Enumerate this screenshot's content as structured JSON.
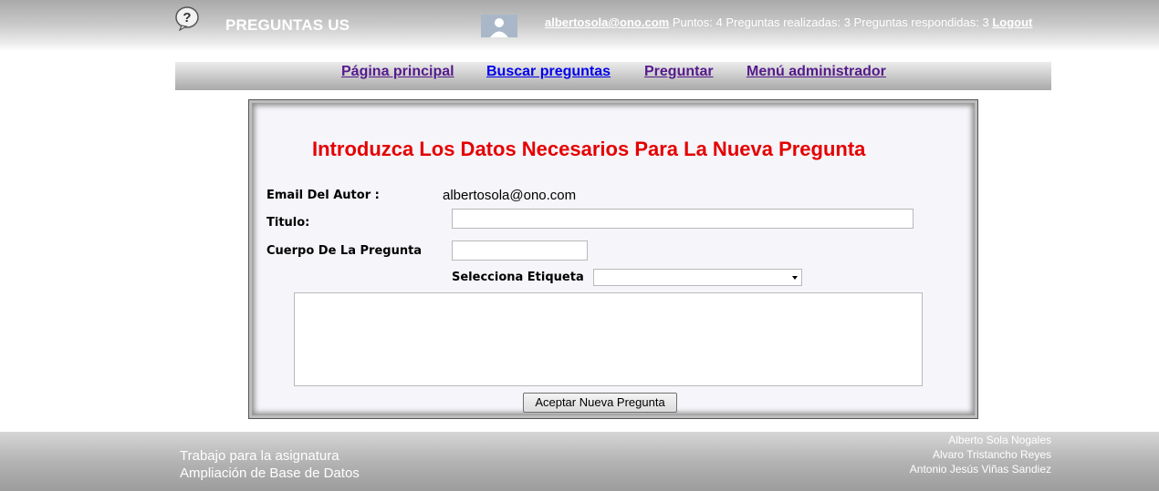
{
  "header": {
    "site_title": "PREGUNTAS US",
    "user_email": "albertosola@ono.com",
    "stats": " Puntos: 4 Preguntas realizadas: 3 Preguntas respondidas: 3 ",
    "logout_label": "Logout",
    "logo_icon": "question-bubble-icon",
    "avatar_icon": "user-avatar-icon"
  },
  "nav": {
    "items": [
      {
        "label": "Página principal"
      },
      {
        "label": "Buscar preguntas"
      },
      {
        "label": "Preguntar"
      },
      {
        "label": "Menú administrador"
      }
    ]
  },
  "form": {
    "title": "Introduzca Los Datos Necesarios Para La Nueva Pregunta",
    "author_label": "Email Del Autor :",
    "author_value": "albertosola@ono.com",
    "title_label": "Titulo:",
    "title_value": "",
    "body_label": "Cuerpo De La Pregunta",
    "body_value": "",
    "tag_label": "Selecciona Etiqueta",
    "tag_value": "",
    "textarea_value": "",
    "submit_label": "Aceptar Nueva Pregunta"
  },
  "footer": {
    "left_line1": "Trabajo para la asignatura",
    "left_line2": "Ampliación de Base de Datos",
    "authors": [
      "Alberto Sola Nogales",
      "Alvaro Tristancho Reyes",
      "Antonio Jesús Viñas Sandiez"
    ]
  },
  "colors": {
    "title_red": "#e50000",
    "link_visited": "#551a8b",
    "link_active": "#0000ee"
  }
}
